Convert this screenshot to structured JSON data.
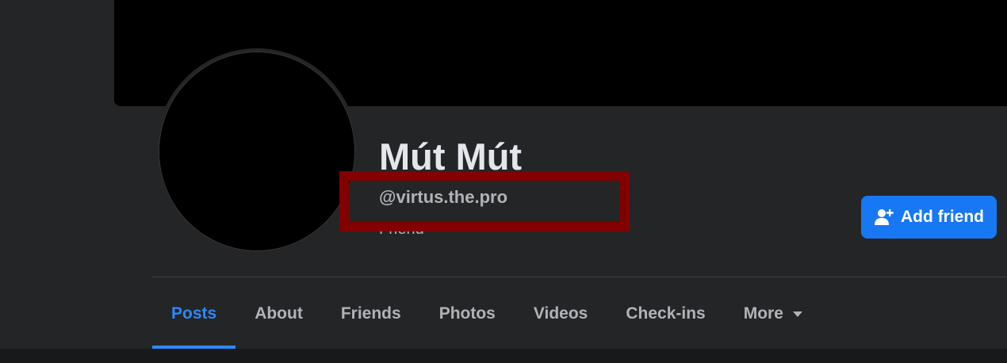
{
  "profile": {
    "name": "Mút Mút",
    "username": "@virtus.the.pro",
    "friend_status": "Friend"
  },
  "actions": {
    "add_friend_label": "Add friend",
    "add_friend_icon": "person-add-icon"
  },
  "tabs": [
    {
      "label": "Posts",
      "active": true
    },
    {
      "label": "About"
    },
    {
      "label": "Friends"
    },
    {
      "label": "Photos"
    },
    {
      "label": "Videos"
    },
    {
      "label": "Check-ins"
    },
    {
      "label": "More",
      "icon": "caret-down-icon"
    }
  ],
  "colors": {
    "accent": "#2d88ff",
    "button": "#1877f2",
    "highlight": "#830000",
    "surface": "#242526"
  }
}
